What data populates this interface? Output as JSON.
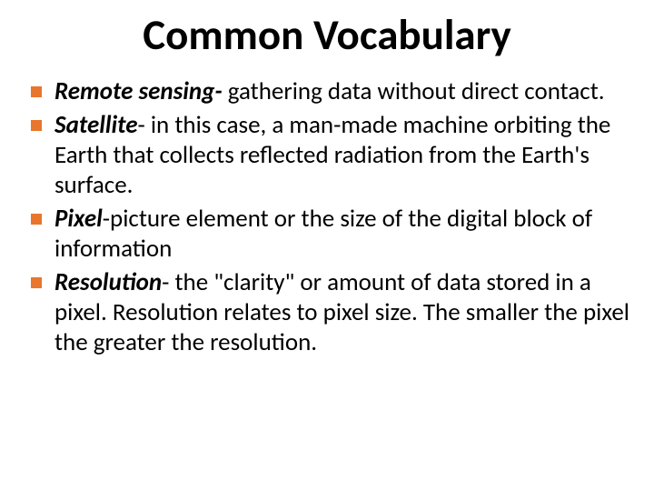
{
  "title": "Common Vocabulary",
  "bullets": [
    {
      "term": "Remote sensing- ",
      "def": "gathering data without direct contact."
    },
    {
      "term": "Satellite",
      "def": "- in this case, a man-made machine orbiting the Earth that collects reflected radiation from the Earth's surface."
    },
    {
      "term": "Pixel",
      "def": "-picture element or the size of the digital block of information"
    },
    {
      "term": "Resolution",
      "def": "- the \"clarity\" or amount of data stored in a pixel. Resolution relates to pixel size. The smaller the pixel the greater the resolution."
    }
  ]
}
